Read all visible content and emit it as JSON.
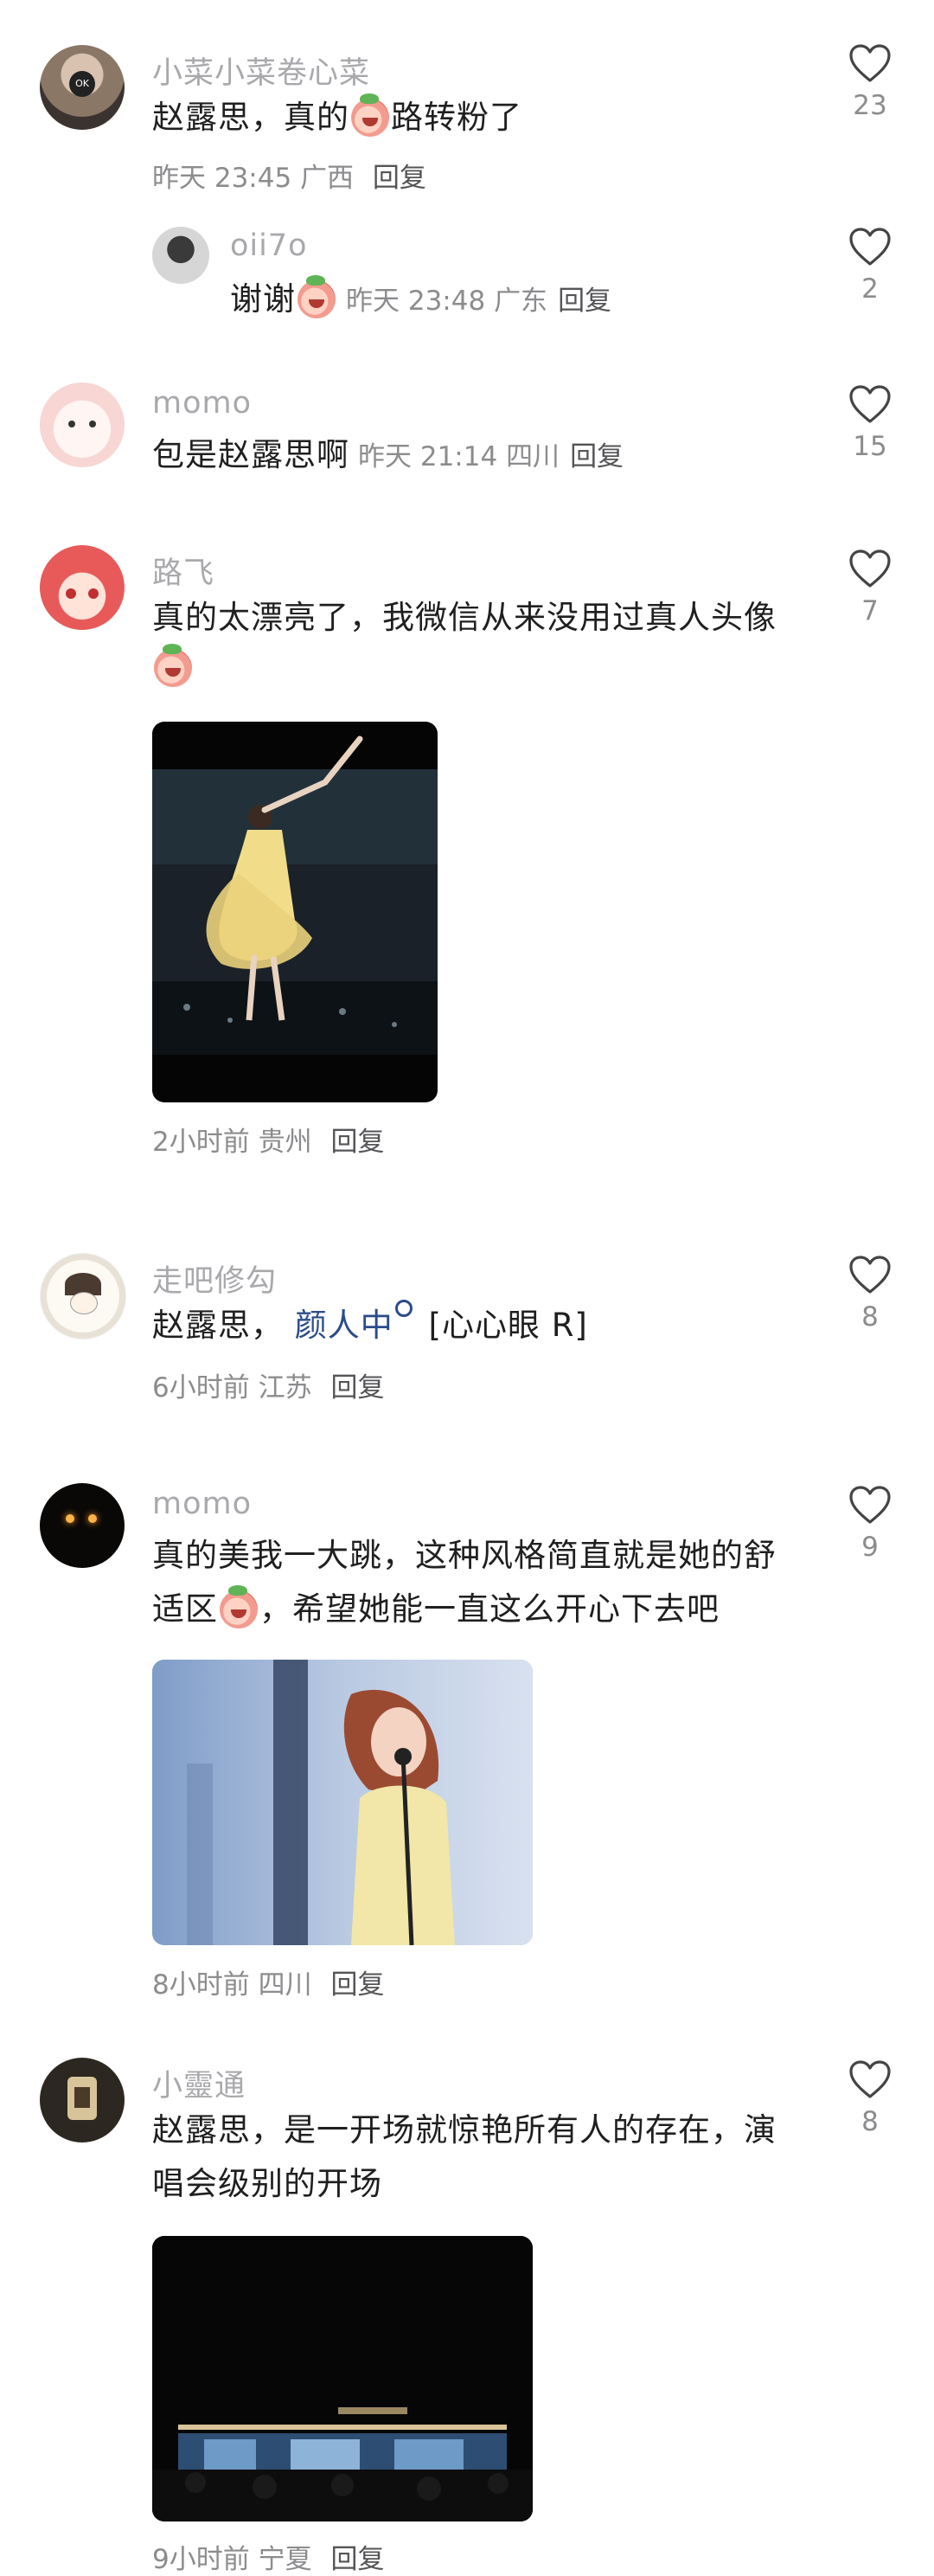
{
  "comments": [
    {
      "username": "小菜小菜卷心菜",
      "avatar": "ok-circle-avatar",
      "text_before": "赵露思，真的",
      "text_after": "路转粉了",
      "emoji": "peach-emoji",
      "time": "昨天 23:45",
      "location": "广西",
      "reply": "回复",
      "likes": "23"
    },
    {
      "username": "oii7o",
      "avatar": "girl-photo-avatar",
      "text_before": "谢谢",
      "emoji": "peach-emoji",
      "time": "昨天 23:48",
      "location": "广东",
      "reply": "回复",
      "likes": "2"
    },
    {
      "username": "momo",
      "avatar": "pink-cartoon-avatar",
      "text": "包是赵露思啊",
      "time": "昨天 21:14",
      "location": "四川",
      "reply": "回复",
      "likes": "15"
    },
    {
      "username": "路飞",
      "avatar": "cartoon-girl-avatar",
      "text": "真的太漂亮了，我微信从来没用过真人头像",
      "emoji": "peach-emoji",
      "image": "concert-photo-yellow-dress",
      "time": "2小时前",
      "location": "贵州",
      "reply": "回复",
      "likes": "7"
    },
    {
      "username": "走吧修勾",
      "avatar": "sketch-girl-avatar",
      "text_before": "赵露思，",
      "link": "颜人中",
      "text_after": "[心心眼 R]",
      "time": "6小时前",
      "location": "江苏",
      "reply": "回复",
      "likes": "8"
    },
    {
      "username": "momo",
      "avatar": "dark-lights-avatar",
      "line1": "真的美我一大跳，这种风格简直就是她的舒",
      "line2_before": "适区",
      "line2_after": "，希望她能一直这么开心下去吧",
      "emoji": "crying-emoji",
      "image": "singer-microphone-photo",
      "time": "8小时前",
      "location": "四川",
      "reply": "回复",
      "likes": "9"
    },
    {
      "username": "小靈通",
      "avatar": "window-scene-avatar",
      "line1": "赵露思，是一开场就惊艳所有人的存在，演",
      "line2": "唱会级别的开场",
      "image": "stage-wide-photo",
      "time": "9小时前",
      "location": "宁夏",
      "reply": "回复",
      "likes": "8"
    }
  ]
}
